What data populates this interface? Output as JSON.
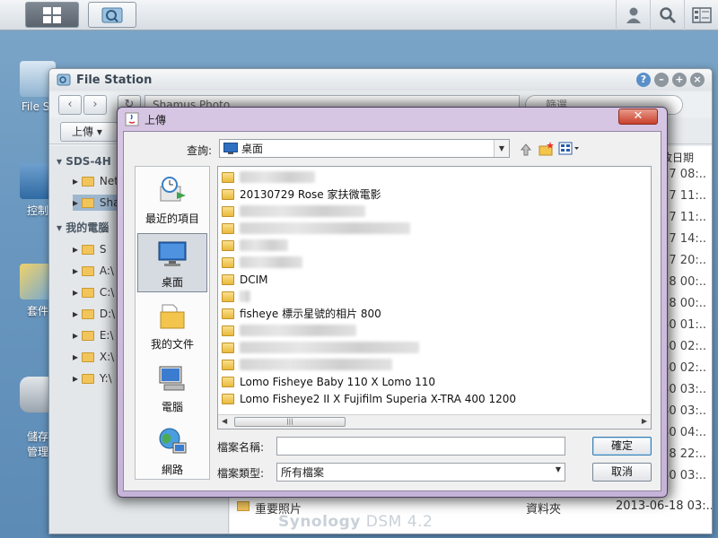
{
  "file_station": {
    "title": "File Station",
    "path": "Shamus Photo",
    "search_placeholder": "篩選",
    "upload_label": "上傳",
    "date_column": "改日期",
    "tree": {
      "server": "SDS-4H",
      "server_items": [
        "Net",
        "Sha"
      ],
      "my_computer": "我的電腦",
      "drives": [
        "S",
        "A:\\",
        "C:\\",
        "D:\\",
        "E:\\",
        "X:\\",
        "Y:\\"
      ]
    },
    "dates": [
      "27 08:..",
      "27 11:..",
      "27 11:..",
      "27 14:..",
      "27 20:..",
      "28 00:..",
      "28 00:..",
      "30 01:..",
      "30 02:..",
      "30 02:..",
      "30 03:..",
      "30 03:..",
      "30 04:..",
      "28 22:..",
      "30 03:.."
    ],
    "bottom_row": {
      "name": "重要照片",
      "type": "資料夾",
      "date": "2013-06-18 03:.."
    }
  },
  "desktop": {
    "icons": [
      "File St",
      "控制",
      "套件",
      "儲存\n管理"
    ]
  },
  "footer": {
    "brand": "Synology",
    "version": "DSM 4.2"
  },
  "dialog": {
    "title": "上傳",
    "close_label": "✕",
    "look_in_label": "查詢:",
    "look_in_value": "桌面",
    "places": [
      "最近的項目",
      "桌面",
      "我的文件",
      "電腦",
      "網路"
    ],
    "files": [
      {
        "name": "",
        "blurred": true
      },
      {
        "name": "20130729 Rose 家扶微電影",
        "blurred": false
      },
      {
        "name": "",
        "blurred": true
      },
      {
        "name": "",
        "blurred": true
      },
      {
        "name": "",
        "blurred": true
      },
      {
        "name": "",
        "blurred": true
      },
      {
        "name": "DCIM",
        "blurred": false
      },
      {
        "name": "",
        "blurred": true
      },
      {
        "name": "fisheye 標示星號的相片 800",
        "blurred": false
      },
      {
        "name": "",
        "blurred": true
      },
      {
        "name": "",
        "blurred": true
      },
      {
        "name": "",
        "blurred": true
      },
      {
        "name": "Lomo Fisheye Baby 110 X Lomo 110",
        "blurred": false
      },
      {
        "name": "Lomo Fisheye2 II X Fujifilm Superia X-TRA 400 1200",
        "blurred": false
      }
    ],
    "filename_label": "檔案名稱:",
    "filename_value": "",
    "filetype_label": "檔案類型:",
    "filetype_value": "所有檔案",
    "ok_label": "確定",
    "cancel_label": "取消"
  },
  "colors": {
    "desktop": "#6a98c0",
    "dialog_frame": "#c9b7da",
    "close_red": "#c8412c",
    "folder": "#e9b93c"
  }
}
